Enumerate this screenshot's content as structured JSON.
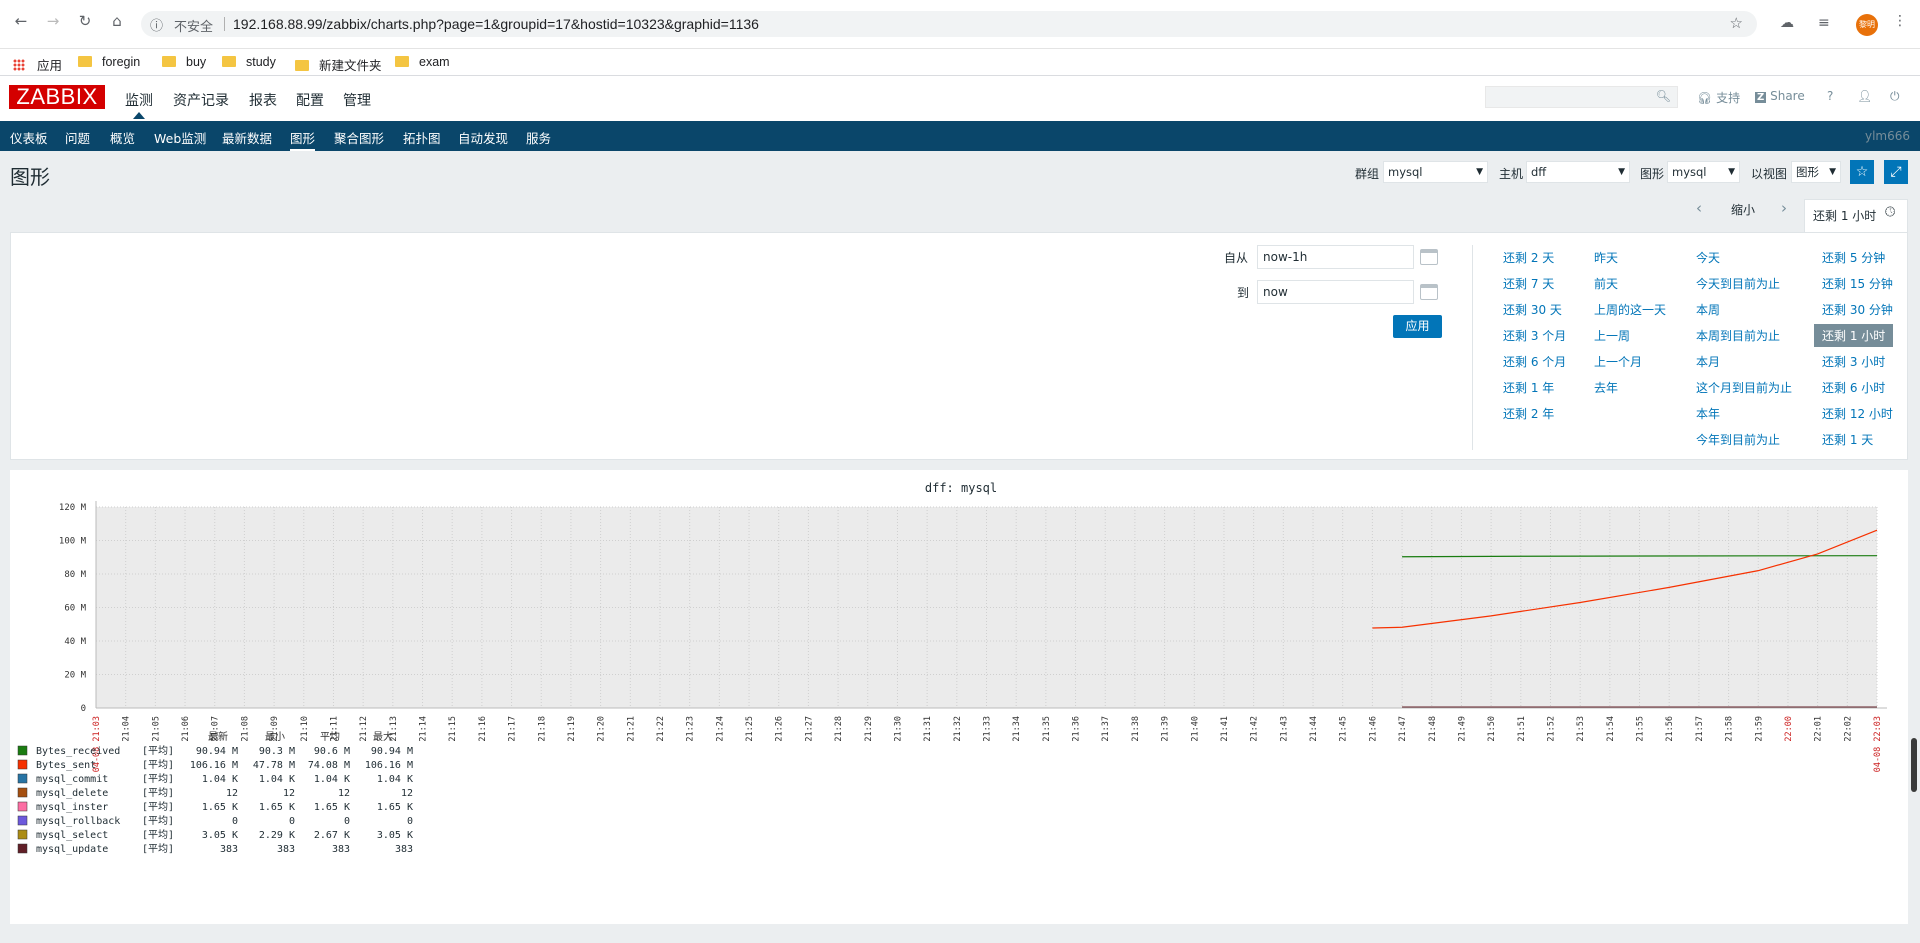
{
  "browser": {
    "insecure_label": "不安全",
    "url": "192.168.88.99/zabbix/charts.php?page=1&groupid=17&hostid=10323&graphid=1136",
    "profile_label": "黎明"
  },
  "bookmarks": [
    {
      "label": "应用",
      "icon": "apps-grid-icon"
    },
    {
      "label": "foregin",
      "icon": "folder-icon"
    },
    {
      "label": "buy",
      "icon": "folder-icon"
    },
    {
      "label": "study",
      "icon": "folder-icon"
    },
    {
      "label": "新建文件夹",
      "icon": "folder-icon"
    },
    {
      "label": "exam",
      "icon": "folder-icon"
    }
  ],
  "header": {
    "logo": "ZABBIX",
    "menu": [
      "监测",
      "资产记录",
      "报表",
      "配置",
      "管理"
    ],
    "support": "支持",
    "share": "Share",
    "help": "?",
    "user_icon": "user-icon",
    "logout_icon": "power-icon"
  },
  "submenu": {
    "items": [
      "仪表板",
      "问题",
      "概览",
      "Web监测",
      "最新数据",
      "图形",
      "聚合图形",
      "拓扑图",
      "自动发现",
      "服务"
    ],
    "user": "ylm666"
  },
  "page": {
    "title": "图形",
    "group_label": "群组",
    "group_value": "mysql",
    "host_label": "主机",
    "host_value": "dff",
    "graph_label": "图形",
    "graph_value": "mysql",
    "view_label": "以视图",
    "view_value": "图形"
  },
  "timebar": {
    "zoom_out": "缩小",
    "active": "还剩 1 小时"
  },
  "filter": {
    "from_label": "自从",
    "from_value": "now-1h",
    "to_label": "到",
    "to_value": "now",
    "apply": "应用",
    "quick": [
      [
        "还剩 2 天",
        "还剩 7 天",
        "还剩 30 天",
        "还剩 3 个月",
        "还剩 6 个月",
        "还剩 1 年",
        "还剩 2 年"
      ],
      [
        "昨天",
        "前天",
        "上周的这一天",
        "上一周",
        "上一个月",
        "去年"
      ],
      [
        "今天",
        "今天到目前为止",
        "本周",
        "本周到目前为止",
        "本月",
        "这个月到目前为止",
        "本年",
        "今年到目前为止"
      ],
      [
        "还剩 5 分钟",
        "还剩 15 分钟",
        "还剩 30 分钟",
        "还剩 1 小时",
        "还剩 3 小时",
        "还剩 6 小时",
        "还剩 12 小时",
        "还剩 1 天"
      ]
    ],
    "selected": "还剩 1 小时"
  },
  "chart_data": {
    "type": "line",
    "title": "dff: mysql",
    "ylim": [
      0,
      120
    ],
    "y_unit": "M",
    "y_ticks": [
      "0",
      "20 M",
      "40 M",
      "60 M",
      "80 M",
      "100 M",
      "120 M"
    ],
    "x_ticks": [
      "04-08 21:03",
      "21:04",
      "21:05",
      "21:06",
      "21:07",
      "21:08",
      "21:09",
      "21:10",
      "21:11",
      "21:12",
      "21:13",
      "21:14",
      "21:15",
      "21:16",
      "21:17",
      "21:18",
      "21:19",
      "21:20",
      "21:21",
      "21:22",
      "21:23",
      "21:24",
      "21:25",
      "21:26",
      "21:27",
      "21:28",
      "21:29",
      "21:30",
      "21:31",
      "21:32",
      "21:33",
      "21:34",
      "21:35",
      "21:36",
      "21:37",
      "21:38",
      "21:39",
      "21:40",
      "21:41",
      "21:42",
      "21:43",
      "21:44",
      "21:45",
      "21:46",
      "21:47",
      "21:48",
      "21:49",
      "21:50",
      "21:51",
      "21:52",
      "21:53",
      "21:54",
      "21:55",
      "21:56",
      "21:57",
      "21:58",
      "21:59",
      "22:00",
      "22:01",
      "22:02",
      "04-08 22:03"
    ],
    "legend_headers": [
      "最新",
      "最小",
      "平均",
      "最大"
    ],
    "series": [
      {
        "name": "Bytes_received",
        "color": "#1a7c11",
        "func": "[平均]",
        "last": "90.94 M",
        "min": "90.3 M",
        "avg": "90.6 M",
        "max": "90.94 M",
        "x": [
          "21:47",
          "21:51",
          "22:03"
        ],
        "values": [
          90.3,
          90.6,
          90.94
        ]
      },
      {
        "name": "Bytes_sent",
        "color": "#f63100",
        "func": "[平均]",
        "last": "106.16 M",
        "min": "47.78 M",
        "avg": "74.08 M",
        "max": "106.16 M",
        "x": [
          "21:46",
          "21:47",
          "21:50",
          "21:53",
          "21:56",
          "21:59",
          "22:01",
          "22:03"
        ],
        "values": [
          47.78,
          48.2,
          55,
          63,
          72,
          82,
          92,
          106.16
        ]
      },
      {
        "name": "mysql_commit",
        "color": "#2774a4",
        "func": "[平均]",
        "last": "1.04 K",
        "min": "1.04 K",
        "avg": "1.04 K",
        "max": "1.04 K"
      },
      {
        "name": "mysql_delete",
        "color": "#a54f10",
        "func": "[平均]",
        "last": "12",
        "min": "12",
        "avg": "12",
        "max": "12"
      },
      {
        "name": "mysql_inster",
        "color": "#fc6ea3",
        "func": "[平均]",
        "last": "1.65 K",
        "min": "1.65 K",
        "avg": "1.65 K",
        "max": "1.65 K"
      },
      {
        "name": "mysql_rollback",
        "color": "#6c59dc",
        "func": "[平均]",
        "last": "0",
        "min": "0",
        "avg": "0",
        "max": "0"
      },
      {
        "name": "mysql_select",
        "color": "#ac8c14",
        "func": "[平均]",
        "last": "3.05 K",
        "min": "2.29 K",
        "avg": "2.67 K",
        "max": "3.05 K"
      },
      {
        "name": "mysql_update",
        "color": "#611f27",
        "func": "[平均]",
        "last": "383",
        "min": "383",
        "avg": "383",
        "max": "383"
      }
    ]
  }
}
